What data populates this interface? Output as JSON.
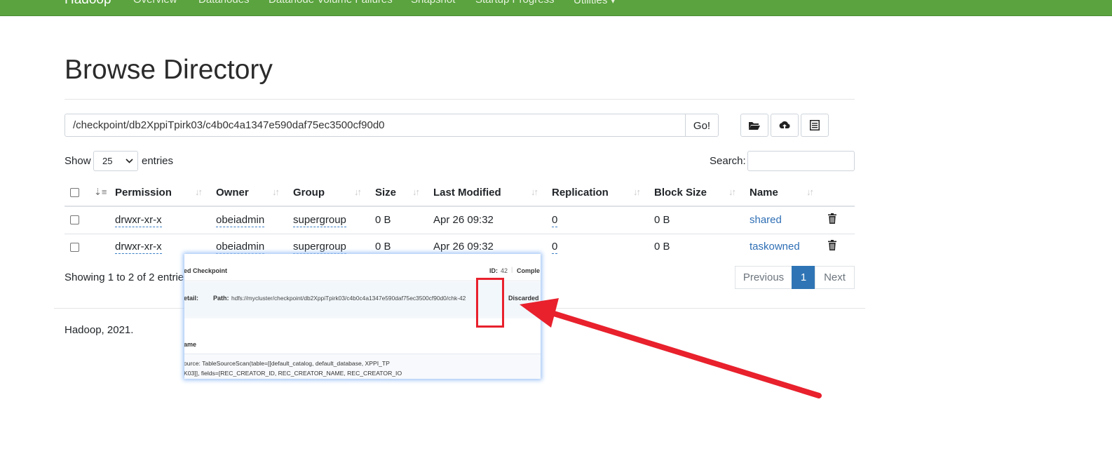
{
  "navbar": {
    "brand": "Hadoop",
    "items": [
      "Overview",
      "Datanodes",
      "Datanode Volume Failures",
      "Snapshot",
      "Startup Progress",
      "Utilities"
    ]
  },
  "page": {
    "title": "Browse Directory"
  },
  "path_bar": {
    "path": "/checkpoint/db2XppiTpirk03/c4b0c4a1347e590daf75ec3500cf90d0",
    "go_label": "Go!",
    "icons": [
      "folder-open-icon",
      "upload-icon",
      "list-icon"
    ]
  },
  "controls": {
    "show_label": "Show",
    "entries_selected": "25",
    "entries_label": "entries",
    "search_label": "Search:"
  },
  "table": {
    "headers": [
      "Permission",
      "Owner",
      "Group",
      "Size",
      "Last Modified",
      "Replication",
      "Block Size",
      "Name"
    ],
    "rows": [
      {
        "permission": "drwxr-xr-x",
        "owner": "obeiadmin",
        "group": "supergroup",
        "size": "0 B",
        "modified": "Apr 26 09:32",
        "replication": "0",
        "block_size": "0 B",
        "name": "shared"
      },
      {
        "permission": "drwxr-xr-x",
        "owner": "obeiadmin",
        "group": "supergroup",
        "size": "0 B",
        "modified": "Apr 26 09:32",
        "replication": "0",
        "block_size": "0 B",
        "name": "taskowned"
      }
    ]
  },
  "info": {
    "showing": "Showing 1 to 2 of 2 entries"
  },
  "pagination": {
    "previous": "Previous",
    "current": "1",
    "next": "Next"
  },
  "footer": {
    "text": "Hadoop, 2021."
  },
  "overlay": {
    "title": "ed Checkpoint",
    "id_label": "ID:",
    "id_value": "42",
    "complete_label": "Comple",
    "detail_label": "etail:",
    "path_label": "Path:",
    "path_value": "hdfs://mycluster/checkpoint/db2XppiTpirk03/c4b0c4a1347e590daf75ec3500cf90d0/chk-42",
    "discarded_label": "Discarded",
    "name_label": "ame",
    "source_line1": "ource: TableSourceScan(table=[[default_catalog, default_database, XPPI_TP",
    "source_line2": "K03]], fields=[REC_CREATOR_ID, REC_CREATOR_NAME, REC_CREATOR_IO"
  },
  "colors": {
    "navbar": "#5aa33f",
    "link": "#2f6fb5",
    "pagination_active": "#2f75b5",
    "annotation": "#e8212d"
  }
}
